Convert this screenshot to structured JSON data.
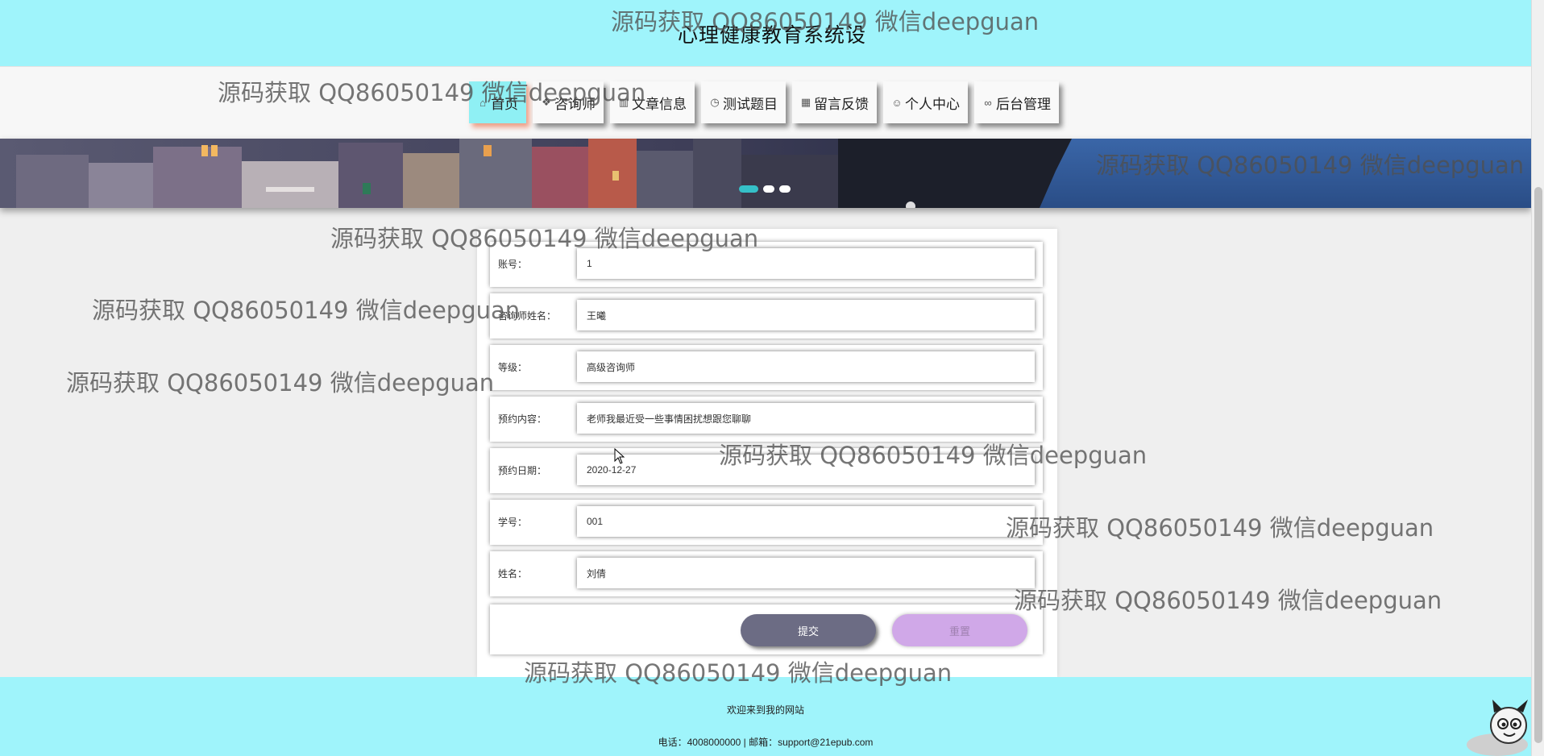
{
  "header": {
    "site_title": "心理健康教育系统设"
  },
  "nav": {
    "items": [
      {
        "label": "首页",
        "icon": "home-icon",
        "glyph": "⌂"
      },
      {
        "label": "咨询师",
        "icon": "layers-icon",
        "glyph": "❖"
      },
      {
        "label": "文章信息",
        "icon": "book-icon",
        "glyph": "▥"
      },
      {
        "label": "测试题目",
        "icon": "clock-icon",
        "glyph": "◷"
      },
      {
        "label": "留言反馈",
        "icon": "grid-icon",
        "glyph": "▦"
      },
      {
        "label": "个人中心",
        "icon": "user-icon",
        "glyph": "☺"
      },
      {
        "label": "后台管理",
        "icon": "link-icon",
        "glyph": "∞"
      }
    ],
    "active_index": 0
  },
  "banner": {
    "slide_count": 3,
    "active_slide": 0
  },
  "form": {
    "fields": [
      {
        "label": "账号：",
        "value": "1"
      },
      {
        "label": "咨询师姓名：",
        "value": "王曦"
      },
      {
        "label": "等级：",
        "value": "高级咨询师"
      },
      {
        "label": "预约内容：",
        "value": "老师我最近受一些事情困扰想跟您聊聊"
      },
      {
        "label": "预约日期：",
        "value": "2020-12-27"
      },
      {
        "label": "学号：",
        "value": "001"
      },
      {
        "label": "姓名：",
        "value": "刘倩"
      }
    ],
    "submit_label": "提交",
    "reset_label": "重置"
  },
  "footer": {
    "welcome": "欢迎来到我的网站",
    "contact": "电话：4008000000 | 邮箱：support@21epub.com"
  },
  "watermark_text": "源码获取 QQ86050149 微信deepguan",
  "colors": {
    "header_bg": "#9ff4fb",
    "nav_active": "#8ff0f4",
    "submit_btn": "#6c6c84",
    "reset_btn": "#d0a8e8"
  }
}
